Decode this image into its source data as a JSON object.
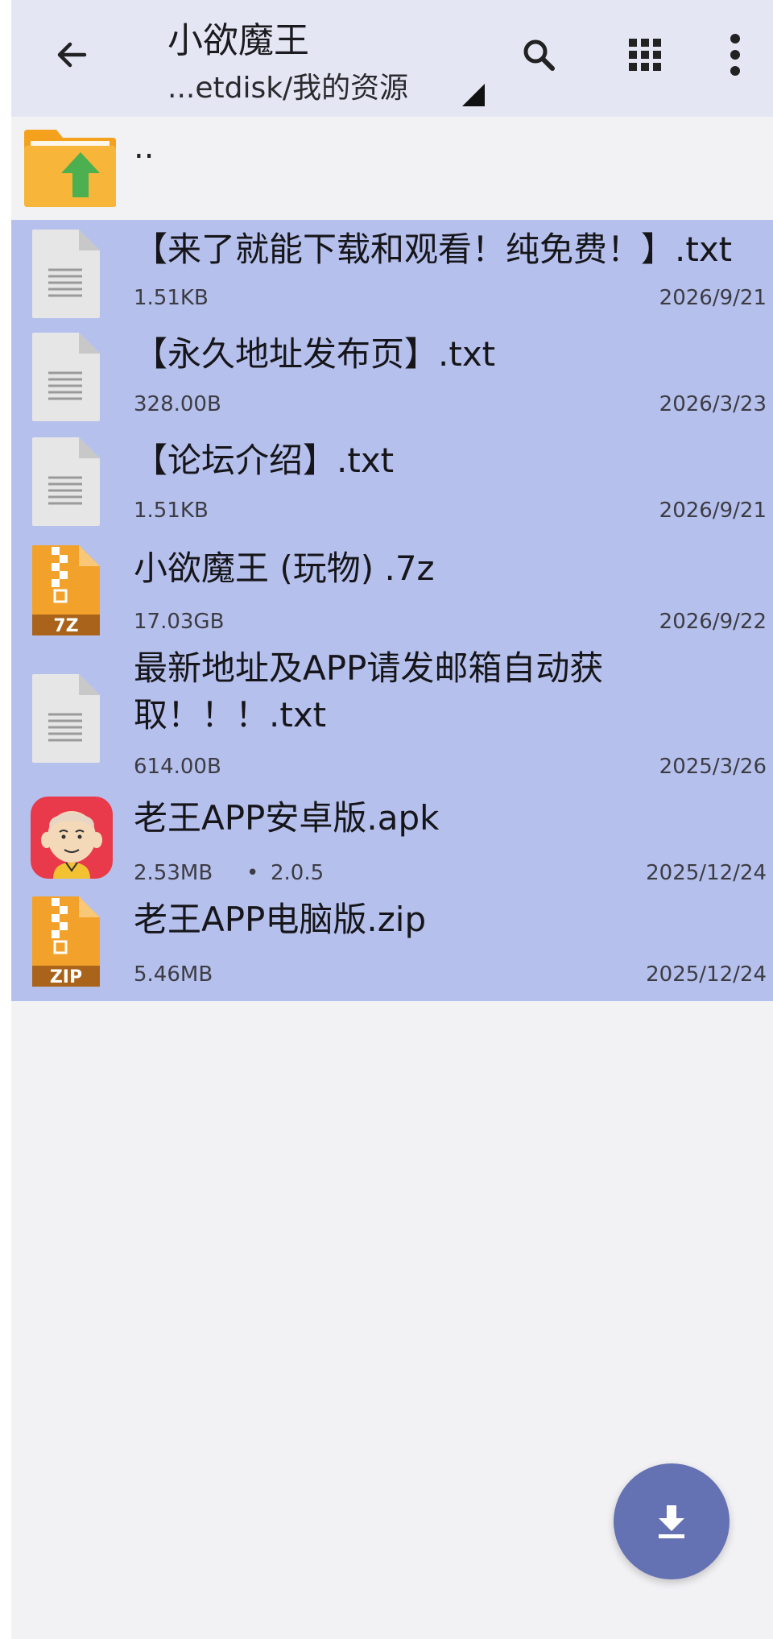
{
  "header": {
    "title": "小欲魔王",
    "path": "...etdisk/我的资源"
  },
  "parent": {
    "label": ".."
  },
  "files": [
    {
      "name": "【来了就能下载和观看！纯免费！】.txt",
      "size": "1.51KB",
      "date": "2026/9/21",
      "icon": "text-file-icon"
    },
    {
      "name": "【永久地址发布页】.txt",
      "size": "328.00B",
      "date": "2026/3/23",
      "icon": "text-file-icon"
    },
    {
      "name": "【论坛介绍】.txt",
      "size": "1.51KB",
      "date": "2026/9/21",
      "icon": "text-file-icon"
    },
    {
      "name": "小欲魔王 (玩物) .7z",
      "size": "17.03GB",
      "date": "2026/9/22",
      "icon": "7z-archive-icon",
      "badge": "7Z"
    },
    {
      "name_line1": "最新地址及APP请发邮箱自动获",
      "name_line2": "取！！！.txt",
      "size": "614.00B",
      "date": "2025/3/26",
      "icon": "text-file-icon"
    },
    {
      "name": "老王APP安卓版.apk",
      "size": "2.53MB",
      "separator": "•",
      "version": "2.0.5",
      "date": "2025/12/24",
      "icon": "apk-app-icon"
    },
    {
      "name": "老王APP电脑版.zip",
      "size": "5.46MB",
      "date": "2025/12/24",
      "icon": "zip-archive-icon",
      "badge": "ZIP"
    }
  ],
  "icons": {
    "back": "arrow-back-icon",
    "search": "search-icon",
    "grid": "grid-view-icon",
    "more": "more-vert-icon",
    "fab": "download-icon"
  },
  "colors": {
    "selection": "#b6c0ec",
    "appbar": "#e4e6f4",
    "fab": "#6471b2",
    "folder": "#f5a623",
    "archive": "#f0a030"
  }
}
